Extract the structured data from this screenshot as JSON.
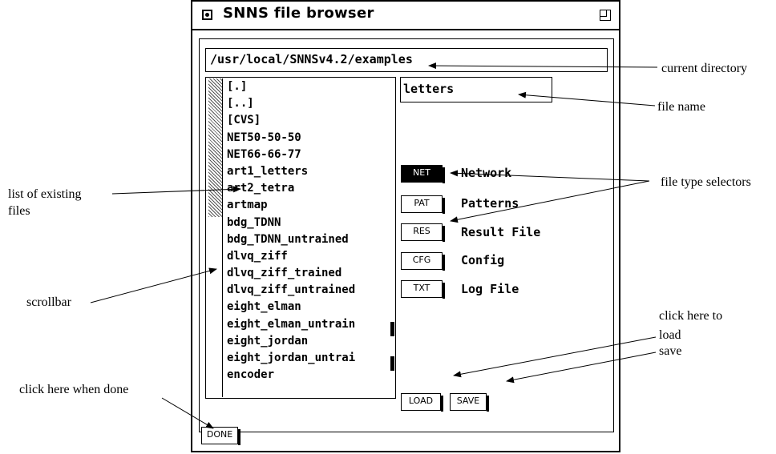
{
  "window": {
    "title": "SNNS file browser",
    "menu_icon": "window-menu-icon",
    "resize_icon": "window-resize-icon"
  },
  "directory": {
    "value": "/usr/local/SNNSv4.2/examples"
  },
  "file_name": {
    "value": "letters"
  },
  "file_list": {
    "items": [
      "[.]",
      "[..]",
      "[CVS]",
      "NET50-50-50",
      "NET66-66-77",
      "art1_letters",
      "art2_tetra",
      "artmap",
      "bdg_TDNN",
      "bdg_TDNN_untrained",
      "dlvq_ziff",
      "dlvq_ziff_trained",
      "dlvq_ziff_untrained",
      "eight_elman",
      "eight_elman_untrain",
      "eight_jordan",
      "eight_jordan_untrai",
      "encoder"
    ]
  },
  "file_types": [
    {
      "button": "NET",
      "label": "Network",
      "selected": true
    },
    {
      "button": "PAT",
      "label": "Patterns",
      "selected": false
    },
    {
      "button": "RES",
      "label": "Result File",
      "selected": false
    },
    {
      "button": "CFG",
      "label": "Config",
      "selected": false
    },
    {
      "button": "TXT",
      "label": "Log File",
      "selected": false
    }
  ],
  "actions": {
    "load": "LOAD",
    "save": "SAVE",
    "done": "DONE"
  },
  "annotations": {
    "current_directory": "current directory",
    "file_name": "file name",
    "file_type_selectors": "file type selectors",
    "list_line1": "list of existing",
    "list_line2": "files",
    "scrollbar": "scrollbar",
    "click_here_to": "click here to",
    "load": "load",
    "save": "save",
    "click_done": "click here when done"
  }
}
